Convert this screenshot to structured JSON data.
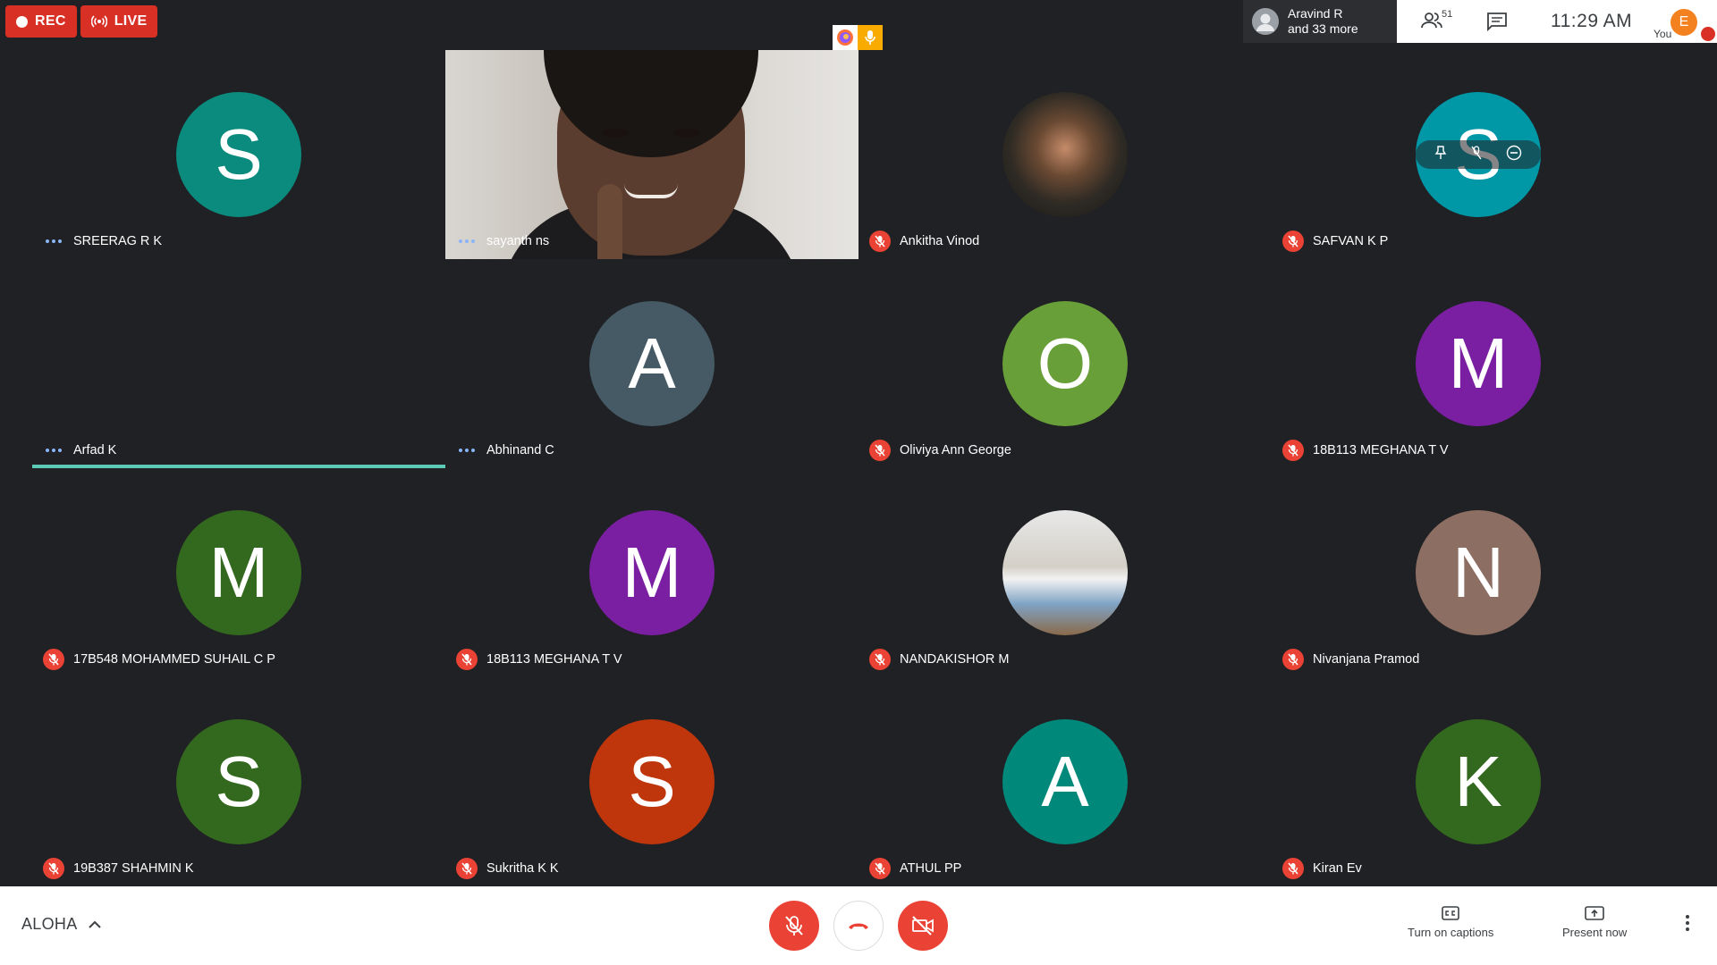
{
  "recording": {
    "rec_label": "REC",
    "live_label": "LIVE",
    "rec_color": "#d93025"
  },
  "presenter": {
    "line1": "Aravind R",
    "line2": "and 33 more"
  },
  "topbar": {
    "participant_count": "51",
    "clock": "11:29 AM",
    "self_initial": "E",
    "self_label": "You",
    "self_color": "#f4811f"
  },
  "tiles": [
    {
      "name": "SREERAG R K",
      "initial": "S",
      "color": "#0b8b7d",
      "status": "speaking"
    },
    {
      "name": "sayanth ns",
      "initial": "",
      "color": "",
      "status": "speaking",
      "video": true
    },
    {
      "name": "Ankitha Vinod",
      "initial": "",
      "color": "",
      "status": "muted",
      "photo": true
    },
    {
      "name": "SAFVAN K P",
      "initial": "S",
      "color": "#0097a7",
      "status": "muted",
      "hover": true
    },
    {
      "name": "Arfad K",
      "initial": "",
      "color": "",
      "status": "speaking",
      "active": true
    },
    {
      "name": "Abhinand C",
      "initial": "A",
      "color": "#455a64",
      "status": "speaking"
    },
    {
      "name": "Oliviya Ann George",
      "initial": "O",
      "color": "#689f38",
      "status": "muted"
    },
    {
      "name": "18B113 MEGHANA T V",
      "initial": "M",
      "color": "#7b1fa2",
      "status": "muted"
    },
    {
      "name": "17B548 MOHAMMED SUHAIL C P",
      "initial": "M",
      "color": "#33691e",
      "status": "muted"
    },
    {
      "name": "18B113 MEGHANA T V",
      "initial": "M",
      "color": "#7b1fa2",
      "status": "muted"
    },
    {
      "name": "NANDAKISHOR M",
      "initial": "",
      "color": "",
      "status": "muted",
      "photo": true
    },
    {
      "name": "Nivanjana Pramod",
      "initial": "N",
      "color": "#8d6e63",
      "status": "muted"
    },
    {
      "name": "19B387 SHAHMIN K",
      "initial": "S",
      "color": "#33691e",
      "status": "muted"
    },
    {
      "name": "Sukritha K K",
      "initial": "S",
      "color": "#bf360c",
      "status": "muted"
    },
    {
      "name": "ATHUL PP",
      "initial": "A",
      "color": "#00897b",
      "status": "muted"
    },
    {
      "name": "Kiran Ev",
      "initial": "K",
      "color": "#33691e",
      "status": "muted"
    }
  ],
  "bottom": {
    "meeting_name": "ALOHA",
    "captions_label": "Turn on captions",
    "present_label": "Present now"
  },
  "icons": {
    "mic_off": "mic-off-icon",
    "hangup": "call-end-icon",
    "cam_off": "videocam-off-icon",
    "captions": "closed-caption-icon",
    "present": "present-to-all-icon",
    "more": "more-vert-icon",
    "people": "people-icon",
    "chat": "chat-icon"
  }
}
